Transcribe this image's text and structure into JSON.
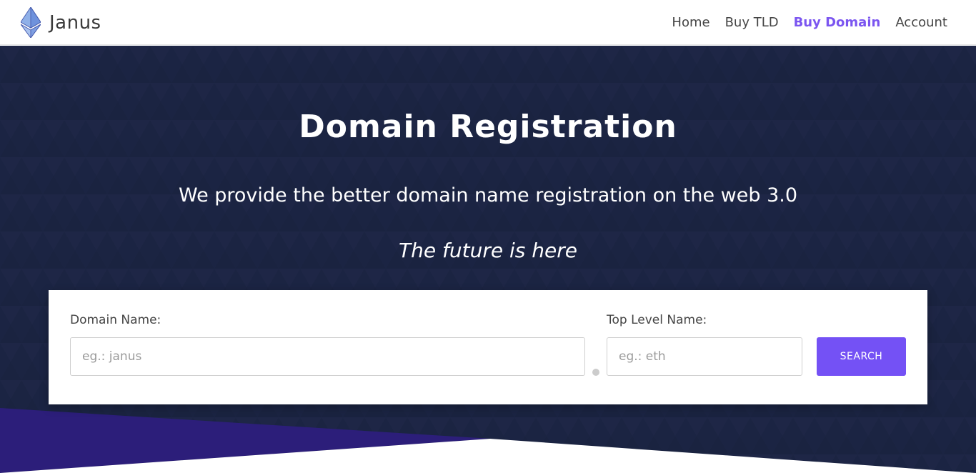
{
  "brand": {
    "name": "Janus",
    "logo_icon": "ethereum-diamond-icon"
  },
  "nav": {
    "items": [
      {
        "label": "Home",
        "active": false
      },
      {
        "label": "Buy TLD",
        "active": false
      },
      {
        "label": "Buy Domain",
        "active": true
      },
      {
        "label": "Account",
        "active": false
      }
    ]
  },
  "hero": {
    "title": "Domain Registration",
    "subtitle": "We provide the better domain name registration on the web 3.0",
    "tagline": "The future is here"
  },
  "search": {
    "domain_label": "Domain Name:",
    "domain_placeholder": "eg.: janus",
    "domain_value": "",
    "tld_label": "Top Level Name:",
    "tld_placeholder": "eg.: eth",
    "tld_value": "",
    "button_label": "SEARCH"
  },
  "colors": {
    "accent": "#7451f5",
    "nav_active": "#7b55f0",
    "hero_background": "#1b2443",
    "purple_wedge": "#2c1e7a"
  }
}
